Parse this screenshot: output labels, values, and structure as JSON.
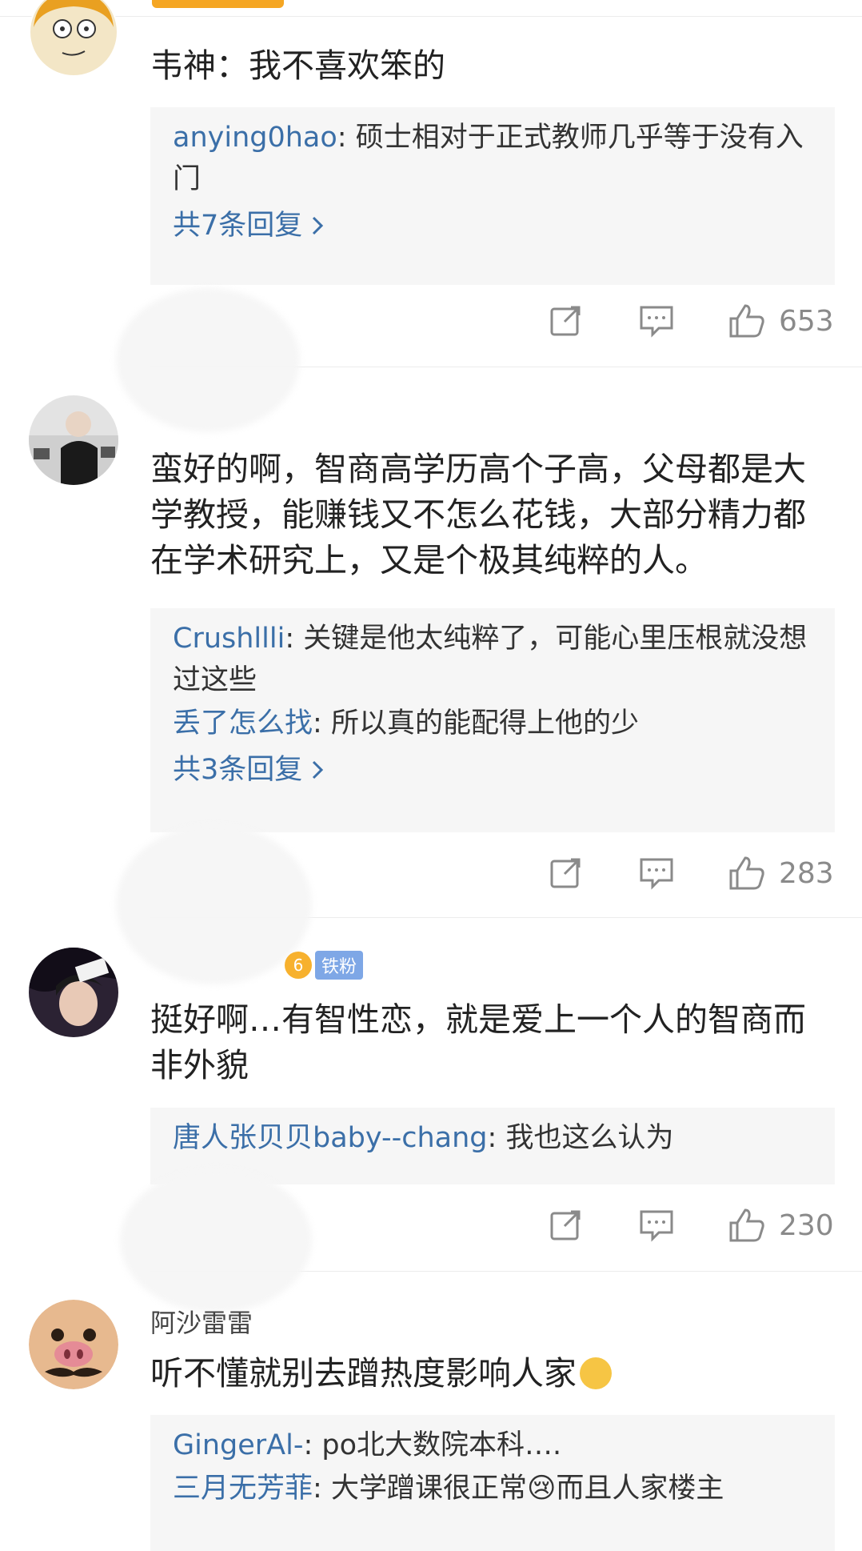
{
  "comments": [
    {
      "username": "",
      "content": "韦神：我不喜欢笨的",
      "replies": [
        {
          "user": "anying0hao",
          "sep": ": ",
          "text": "硕士相对于正式教师几乎等于没有入门"
        }
      ],
      "more": "共7条回复",
      "likes": "653"
    },
    {
      "username": "",
      "content": "蛮好的啊，智商高学历高个子高，父母都是大学教授，能赚钱又不怎么花钱，大部分精力都在学术研究上，又是个极其纯粹的人。",
      "replies": [
        {
          "user": "Crushllli",
          "sep": ": ",
          "text": "关键是他太纯粹了，可能心里压根就没想过这些"
        },
        {
          "user": "丢了怎么找",
          "sep": ": ",
          "text": "所以真的能配得上他的少"
        }
      ],
      "more": "共3条回复",
      "likes": "283"
    },
    {
      "username": "",
      "badge": "铁粉",
      "crown_level": "6",
      "content": "挺好啊…有智性恋，就是爱上一个人的智商而非外貌",
      "replies": [
        {
          "user": "唐人张贝贝baby--chang",
          "sep": ": ",
          "text": "我也这么认为"
        }
      ],
      "likes": "230"
    },
    {
      "username": "阿沙雷雷",
      "content": "听不懂就别去蹭热度影响人家",
      "replies": [
        {
          "user": "GingerAl-",
          "sep": ": ",
          "text": "po北大数院本科…."
        },
        {
          "user": "三月无芳菲",
          "sep": ": ",
          "text": "大学蹭课很正常😢而且人家楼主"
        }
      ]
    }
  ],
  "colors": {
    "link": "#3b6fa8",
    "orange": "#f07f1b",
    "icon": "#8a8a8a"
  },
  "icons": [
    "repost-icon",
    "comment-icon",
    "like-icon",
    "chevron-right-icon"
  ]
}
